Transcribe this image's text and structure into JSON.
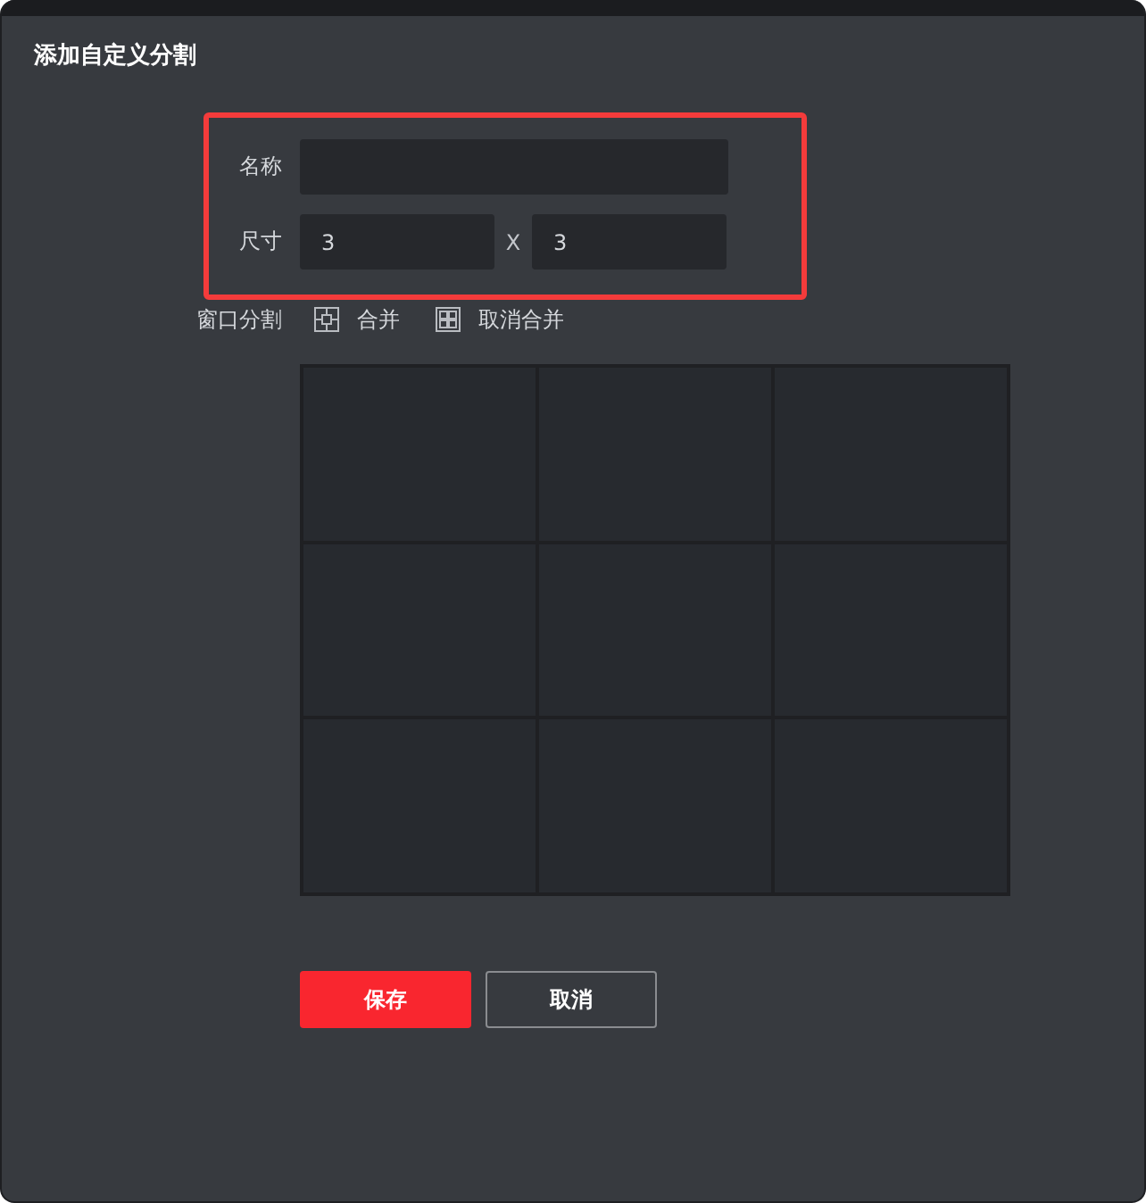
{
  "dialog": {
    "title": "添加自定义分割"
  },
  "form": {
    "highlighted": true,
    "name_field": {
      "label": "名称"
    },
    "size_field": {
      "label": "尺寸",
      "values": [
        "3",
        "3"
      ],
      "separator": "X"
    }
  },
  "window_split": {
    "label": "窗口分割",
    "actions": [
      {
        "kind": "merge",
        "label": "合并"
      },
      {
        "kind": "unmerge",
        "label": "取消合并"
      }
    ]
  },
  "window_grid": {
    "rows": [
      {
        "cells": [
          {
            "selected": false
          },
          {
            "selected": false
          },
          {
            "selected": false
          }
        ]
      },
      {
        "cells": [
          {
            "selected": false
          },
          {
            "selected": false
          },
          {
            "selected": false
          }
        ]
      },
      {
        "cells": [
          {
            "selected": false
          },
          {
            "selected": false
          },
          {
            "selected": false
          }
        ]
      }
    ]
  },
  "buttons": [
    {
      "kind": "primary",
      "label": "保存"
    },
    {
      "kind": "secondary",
      "label": "取消"
    }
  ]
}
